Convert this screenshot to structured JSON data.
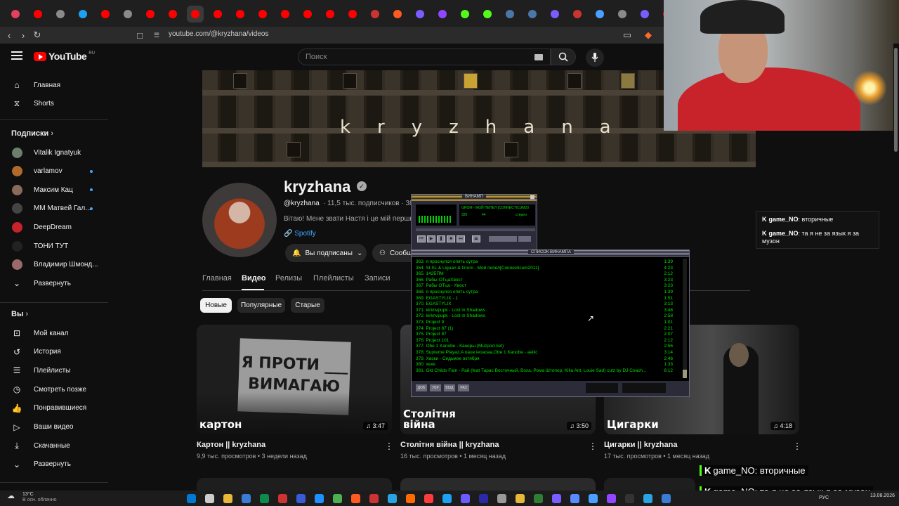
{
  "browser": {
    "url": "youtube.com/@kryzhana/videos"
  },
  "header": {
    "logo_text": "YouTube",
    "logo_region": "RU",
    "search_placeholder": "Поиск"
  },
  "sidebar": {
    "main": [
      {
        "label": "Главная",
        "icon": "home-icon"
      },
      {
        "label": "Shorts",
        "icon": "shorts-icon"
      }
    ],
    "subscriptions_title": "Подписки",
    "subscriptions": [
      {
        "label": "Vitalik Ignatyuk",
        "dot": false,
        "color": "#6b7f6a"
      },
      {
        "label": "varlamov",
        "dot": true,
        "color": "#b06a2c"
      },
      {
        "label": "Максим Кац",
        "dot": true,
        "color": "#8a6a5a"
      },
      {
        "label": "MM Матвей Гал...",
        "dot": true,
        "color": "#444444"
      },
      {
        "label": "DeepDream",
        "dot": false,
        "color": "#c7232b"
      },
      {
        "label": "ТОНИ ТУТ",
        "dot": false,
        "color": "#222222"
      },
      {
        "label": "Владимир Шмонд...",
        "dot": false,
        "color": "#9a6a6a"
      },
      {
        "label": "Развернуть",
        "dot": false,
        "color": ""
      }
    ],
    "you_title": "Вы",
    "you": [
      {
        "label": "Мой канал",
        "icon": "channel-icon"
      },
      {
        "label": "История",
        "icon": "history-icon"
      },
      {
        "label": "Плейлисты",
        "icon": "playlists-icon"
      },
      {
        "label": "Смотреть позже",
        "icon": "watch-later-icon"
      },
      {
        "label": "Понравившиеся",
        "icon": "like-icon"
      },
      {
        "label": "Ваши видео",
        "icon": "your-videos-icon"
      },
      {
        "label": "Скачанные",
        "icon": "download-icon"
      },
      {
        "label": "Развернуть",
        "icon": "chevron-down-icon"
      }
    ]
  },
  "banner": {
    "text": "kryzhana"
  },
  "channel": {
    "name": "kryzhana",
    "handle": "@kryzhana",
    "stats": "· 11,5 тыс. подписчиков · 38 в",
    "description": "Вітаю! Мене звати Настя і це мій перший",
    "link": "Spotify",
    "subscribed_label": "Вы подписаны",
    "community_label": "Сообщ"
  },
  "tabs": [
    "Главная",
    "Видео",
    "Релизы",
    "Плейлисты",
    "Записи"
  ],
  "active_tab": "Видео",
  "chips": [
    "Новые",
    "Популярные",
    "Старые"
  ],
  "videos": [
    {
      "title": "Картон || kryzhana",
      "meta": "9,9 тыс. просмотров • 3 недели назад",
      "duration": "3:47",
      "caption": "картон",
      "sign": "Я ПРОТИ ___ ВИМАГАЮ ___"
    },
    {
      "title": "Столітня війна || kryzhana",
      "meta": "16 тыс. просмотров • 1 месяц назад",
      "duration": "3:50",
      "caption": "Столітня війна"
    },
    {
      "title": "Цигарки || kryzhana",
      "meta": "17 тыс. просмотров • 1 месяц назад",
      "duration": "4:18",
      "caption": "Цигарки"
    }
  ],
  "winamp": {
    "title": "ВИНАМП",
    "track": "GROM - МОЙ ПЕПЕЛ [CONNECTICUM20",
    "kbps": "320",
    "khz": "44",
    "mode": "стерео",
    "playlist_title": "СПИСОК ВИНАМПА",
    "playlist": [
      {
        "name": "363. я проснулся опять сутра",
        "dur": "1:39"
      },
      {
        "name": "364. St.SL & Liguan & Grom - Мой пепел[Connecticum2011]",
        "dur": "4:23"
      },
      {
        "name": "365. 142БПМ",
        "dur": "2:12"
      },
      {
        "name": "366. Рабы-ОТцаХвост",
        "dur": "3:23"
      },
      {
        "name": "367. Рабы ОТца - Хвост",
        "dur": "3:23"
      },
      {
        "name": "368. я проснулся опять сутра",
        "dur": "1:39"
      },
      {
        "name": "369. EGASTYLIX - 1",
        "dur": "1:51"
      },
      {
        "name": "370. EGASTYLIX",
        "dur": "3:13"
      },
      {
        "name": "371. kirknvpupk - Lost in Shadows",
        "dur": "3:48"
      },
      {
        "name": "372. kirknvpupk - Lost in Shadows",
        "dur": "2:58"
      },
      {
        "name": "373. Project 9",
        "dur": "1:01"
      },
      {
        "name": "374. Project 87 (1)",
        "dur": "2:21"
      },
      {
        "name": "375. Project 87",
        "dur": "2:07"
      },
      {
        "name": "376. Project 101",
        "dur": "2:12"
      },
      {
        "name": "377. Obe 1 Kanobe - Канеры (Muzpod.net)",
        "dur": "2:56"
      },
      {
        "name": "378. Supreme Playaz,A oaue ieoaoaa,Obe 1 Kanobe - aeiiic",
        "dur": "3:14"
      },
      {
        "name": "379. Хаски - Седьмое октября",
        "dur": "2:46"
      },
      {
        "name": "380. хехе",
        "dur": "1:33"
      },
      {
        "name": "381. Old Childs Fam - Рай (feat Тарас Восточный, Воха, Рома Штопор, Killa Ant, Louie Sad) cutz by DJ Coach...",
        "dur": "6:12"
      }
    ],
    "footer_buttons": [
      "ДОБ",
      "УБР",
      "ВЫД",
      "РАЗ"
    ]
  },
  "chat": {
    "small": [
      {
        "user": "game_NO",
        "text": ": вторичные"
      },
      {
        "user": "game_NO",
        "text": ": та я не за язык я за музон"
      }
    ],
    "big": [
      {
        "user": "game_NO",
        "text": ": вторичные"
      },
      {
        "user": "game_NO",
        "text": ": та я не за язык я за музон"
      }
    ]
  },
  "taskbar": {
    "temp": "13°C",
    "weather": "В осн. облачно",
    "lang": "РУС",
    "date": "13.08.2026"
  }
}
